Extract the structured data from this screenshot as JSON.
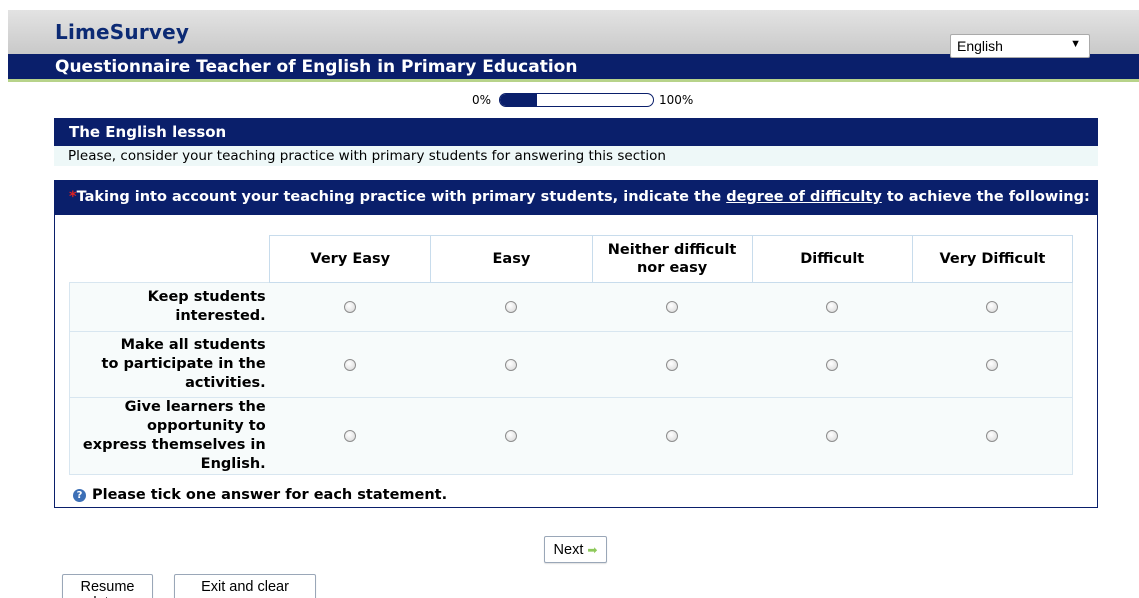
{
  "app": {
    "brand": "LimeSurvey"
  },
  "survey": {
    "title": "Questionnaire Teacher of English in Primary Education"
  },
  "language": {
    "selected": "English"
  },
  "progress": {
    "min_label": "0%",
    "max_label": "100%",
    "value_percent": 0.24
  },
  "group": {
    "title": "The English lesson",
    "description": "Please, consider your teaching practice with primary students for answering this section"
  },
  "question": {
    "asterisk": "*",
    "text_before": "Taking into account your teaching practice with primary students, indicate the ",
    "text_underlined": "degree of difficulty",
    "text_after": " to achieve the following:",
    "columns": [
      "Very Easy",
      "Easy",
      "Neither difficult nor easy",
      "Difficult",
      "Very Difficult"
    ],
    "rows": [
      "Keep students interested.",
      "Make all students to participate in the activities.",
      "Give learners the opportunity to express themselves in English."
    ],
    "help": "Please tick one answer for each statement."
  },
  "buttons": {
    "next": "Next",
    "resume": "Resume later",
    "exit": "Exit and clear survey"
  },
  "colors": {
    "primary": "#0a1f6b",
    "accent": "#b7d38a",
    "required": "#e02020"
  }
}
